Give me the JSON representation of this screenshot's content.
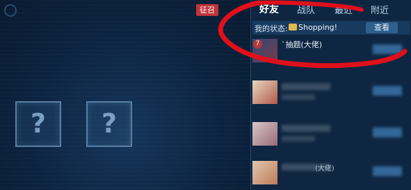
{
  "header": {
    "summon_label": "征召"
  },
  "tabs": [
    {
      "label": "好友",
      "active": true
    },
    {
      "label": "战队",
      "active": false
    },
    {
      "label": "最近",
      "active": false
    },
    {
      "label": "附近",
      "active": false
    }
  ],
  "status": {
    "label": "我的状态:",
    "value": "Shopping!",
    "icon": "shopping-cart-icon",
    "view_button": "查看"
  },
  "friends": [
    {
      "level": "7",
      "name": "`抽题(大佬)"
    },
    {
      "level": "",
      "name": ""
    },
    {
      "level": "",
      "name": ""
    },
    {
      "level": "",
      "name": "(大佬)"
    }
  ],
  "slots": [
    {
      "symbol": "?"
    },
    {
      "symbol": "?"
    }
  ],
  "colors": {
    "annotation": "#e0101a",
    "summon_badge": "#c0343a",
    "panel_bg": "#0e2642"
  }
}
